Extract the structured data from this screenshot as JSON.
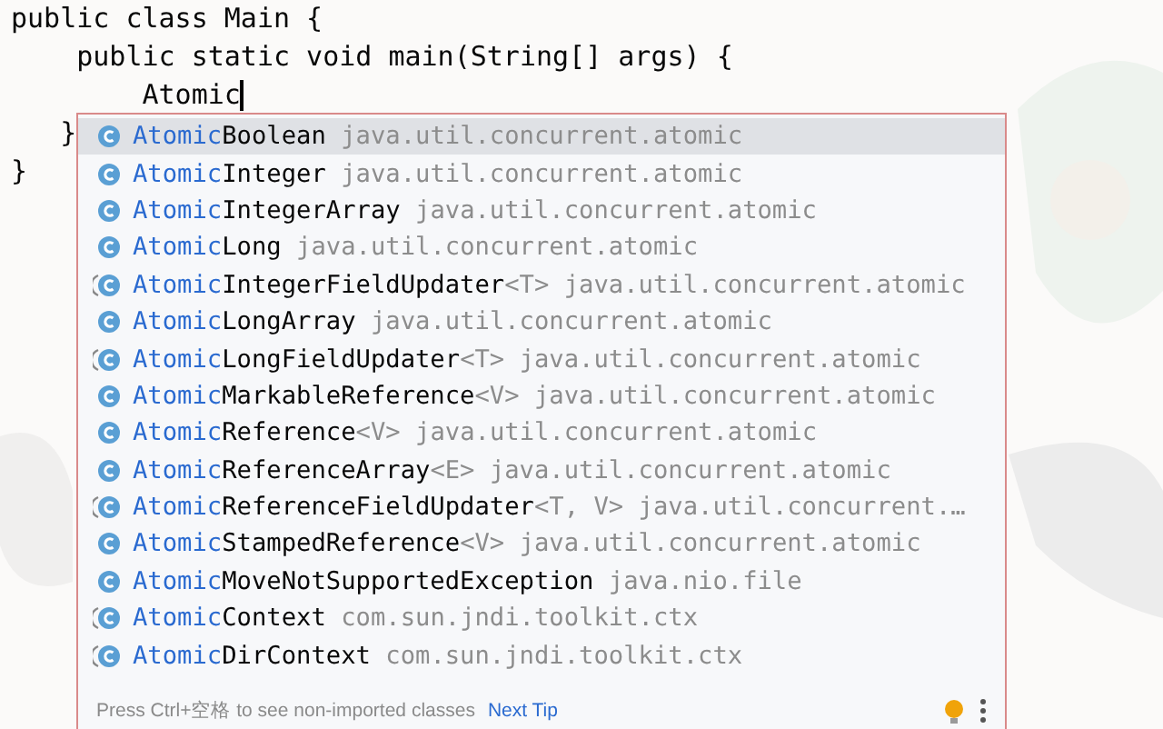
{
  "code_lines": [
    "public class Main {",
    "    public static void main(String[] args) {",
    "        Atomic",
    "   }",
    "}"
  ],
  "completion": {
    "items": [
      {
        "prefix": "Atomic",
        "name": "Boolean",
        "package": "java.util.concurrent.atomic",
        "abstract": false,
        "selected": true
      },
      {
        "prefix": "Atomic",
        "name": "Integer",
        "package": "java.util.concurrent.atomic",
        "abstract": false,
        "selected": false
      },
      {
        "prefix": "Atomic",
        "name": "IntegerArray",
        "package": "java.util.concurrent.atomic",
        "abstract": false,
        "selected": false
      },
      {
        "prefix": "Atomic",
        "name": "Long",
        "package": "java.util.concurrent.atomic",
        "abstract": false,
        "selected": false
      },
      {
        "prefix": "Atomic",
        "name": "IntegerFieldUpdater",
        "generic": "<T>",
        "package": "java.util.concurrent.atomic",
        "abstract": true,
        "selected": false
      },
      {
        "prefix": "Atomic",
        "name": "LongArray",
        "package": "java.util.concurrent.atomic",
        "abstract": false,
        "selected": false
      },
      {
        "prefix": "Atomic",
        "name": "LongFieldUpdater",
        "generic": "<T>",
        "package": "java.util.concurrent.atomic",
        "abstract": true,
        "selected": false
      },
      {
        "prefix": "Atomic",
        "name": "MarkableReference",
        "generic": "<V>",
        "package": "java.util.concurrent.atomic",
        "abstract": false,
        "selected": false
      },
      {
        "prefix": "Atomic",
        "name": "Reference",
        "generic": "<V>",
        "package": "java.util.concurrent.atomic",
        "abstract": false,
        "selected": false
      },
      {
        "prefix": "Atomic",
        "name": "ReferenceArray",
        "generic": "<E>",
        "package": "java.util.concurrent.atomic",
        "abstract": false,
        "selected": false
      },
      {
        "prefix": "Atomic",
        "name": "ReferenceFieldUpdater",
        "generic": "<T, V>",
        "package": "java.util.concurrent.…",
        "abstract": true,
        "selected": false
      },
      {
        "prefix": "Atomic",
        "name": "StampedReference",
        "generic": "<V>",
        "package": "java.util.concurrent.atomic",
        "abstract": false,
        "selected": false
      },
      {
        "prefix": "Atomic",
        "name": "MoveNotSupportedException",
        "package": "java.nio.file",
        "abstract": false,
        "selected": false
      },
      {
        "prefix": "Atomic",
        "name": "Context",
        "package": "com.sun.jndi.toolkit.ctx",
        "abstract": true,
        "selected": false
      },
      {
        "prefix": "Atomic",
        "name": "DirContext",
        "package": "com.sun.jndi.toolkit.ctx",
        "abstract": true,
        "selected": false
      }
    ],
    "footer": {
      "hint": "Press Ctrl+空格 to see non-imported classes",
      "link": "Next Tip"
    }
  }
}
